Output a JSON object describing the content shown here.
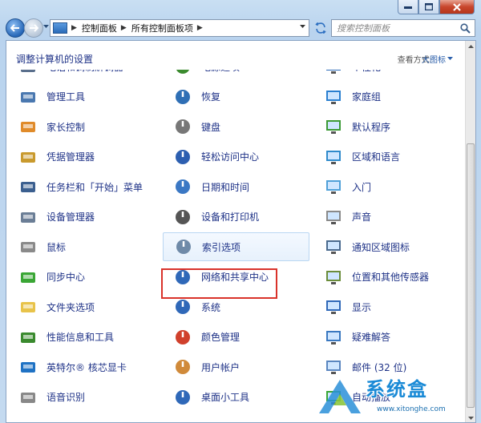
{
  "nav": {
    "breadcrumbs": [
      "控制面板",
      "所有控制面板项"
    ],
    "search_placeholder": "搜索控制面板"
  },
  "content": {
    "title": "调整计算机的设置",
    "view_by_label": "查看方式:",
    "view_by_value": "大图标"
  },
  "items": [
    {
      "label": "电话和调制解调器",
      "icon": "phone-modem-icon",
      "color": "#5a6f8c"
    },
    {
      "label": "电源选项",
      "icon": "power-options-icon",
      "color": "#3a8a2e"
    },
    {
      "label": "个性化",
      "icon": "personalization-icon",
      "color": "#2c6ab8"
    },
    {
      "label": "管理工具",
      "icon": "admin-tools-icon",
      "color": "#4a78b0"
    },
    {
      "label": "恢复",
      "icon": "recovery-icon",
      "color": "#2f6fb5"
    },
    {
      "label": "家庭组",
      "icon": "homegroup-icon",
      "color": "#2a7fd0"
    },
    {
      "label": "家长控制",
      "icon": "parental-controls-icon",
      "color": "#e08b2a"
    },
    {
      "label": "键盘",
      "icon": "keyboard-icon",
      "color": "#777777"
    },
    {
      "label": "默认程序",
      "icon": "default-programs-icon",
      "color": "#3c9a35"
    },
    {
      "label": "凭据管理器",
      "icon": "credential-manager-icon",
      "color": "#c99a2e"
    },
    {
      "label": "轻松访问中心",
      "icon": "ease-of-access-icon",
      "color": "#2d5fb0"
    },
    {
      "label": "区域和语言",
      "icon": "region-language-icon",
      "color": "#2f8acb"
    },
    {
      "label": "任务栏和「开始」菜单",
      "icon": "taskbar-start-menu-icon",
      "color": "#3b5f8f"
    },
    {
      "label": "日期和时间",
      "icon": "date-time-icon",
      "color": "#3b78c4"
    },
    {
      "label": "入门",
      "icon": "getting-started-icon",
      "color": "#4fa0d8"
    },
    {
      "label": "设备管理器",
      "icon": "device-manager-icon",
      "color": "#6b7e96"
    },
    {
      "label": "设备和打印机",
      "icon": "devices-printers-icon",
      "color": "#555555"
    },
    {
      "label": "声音",
      "icon": "sound-icon",
      "color": "#8a8a8a"
    },
    {
      "label": "鼠标",
      "icon": "mouse-icon",
      "color": "#8a8a8a"
    },
    {
      "label": "索引选项",
      "icon": "indexing-options-icon",
      "color": "#6f8aa8"
    },
    {
      "label": "通知区域图标",
      "icon": "notification-area-icon",
      "color": "#4a6a8e"
    },
    {
      "label": "同步中心",
      "icon": "sync-center-icon",
      "color": "#3aa635"
    },
    {
      "label": "网络和共享中心",
      "icon": "network-sharing-icon",
      "color": "#2f68b8"
    },
    {
      "label": "位置和其他传感器",
      "icon": "location-sensors-icon",
      "color": "#6b8d3a"
    },
    {
      "label": "文件夹选项",
      "icon": "folder-options-icon",
      "color": "#e8c34a"
    },
    {
      "label": "系统",
      "icon": "system-icon",
      "color": "#2f68b8"
    },
    {
      "label": "显示",
      "icon": "display-icon",
      "color": "#2f68b8"
    },
    {
      "label": "性能信息和工具",
      "icon": "performance-tools-icon",
      "color": "#3a8a2e"
    },
    {
      "label": "颜色管理",
      "icon": "color-management-icon",
      "color": "#d0402c"
    },
    {
      "label": "疑难解答",
      "icon": "troubleshooting-icon",
      "color": "#3a78c0"
    },
    {
      "label": "英特尔® 核芯显卡",
      "icon": "intel-graphics-icon",
      "color": "#1f72c4"
    },
    {
      "label": "用户帐户",
      "icon": "user-accounts-icon",
      "color": "#d08a3a"
    },
    {
      "label": "邮件 (32 位)",
      "icon": "mail-icon",
      "color": "#5a86c0"
    },
    {
      "label": "语音识别",
      "icon": "speech-recognition-icon",
      "color": "#888888"
    },
    {
      "label": "桌面小工具",
      "icon": "desktop-gadgets-icon",
      "color": "#2f68b8"
    },
    {
      "label": "自动播放",
      "icon": "autoplay-icon",
      "color": "#3aa635"
    }
  ],
  "highlighted_item": "网络和共享中心",
  "hovered_item": "索引选项",
  "watermark": {
    "text": "系统盒",
    "url": "www.xitonghe.com"
  }
}
